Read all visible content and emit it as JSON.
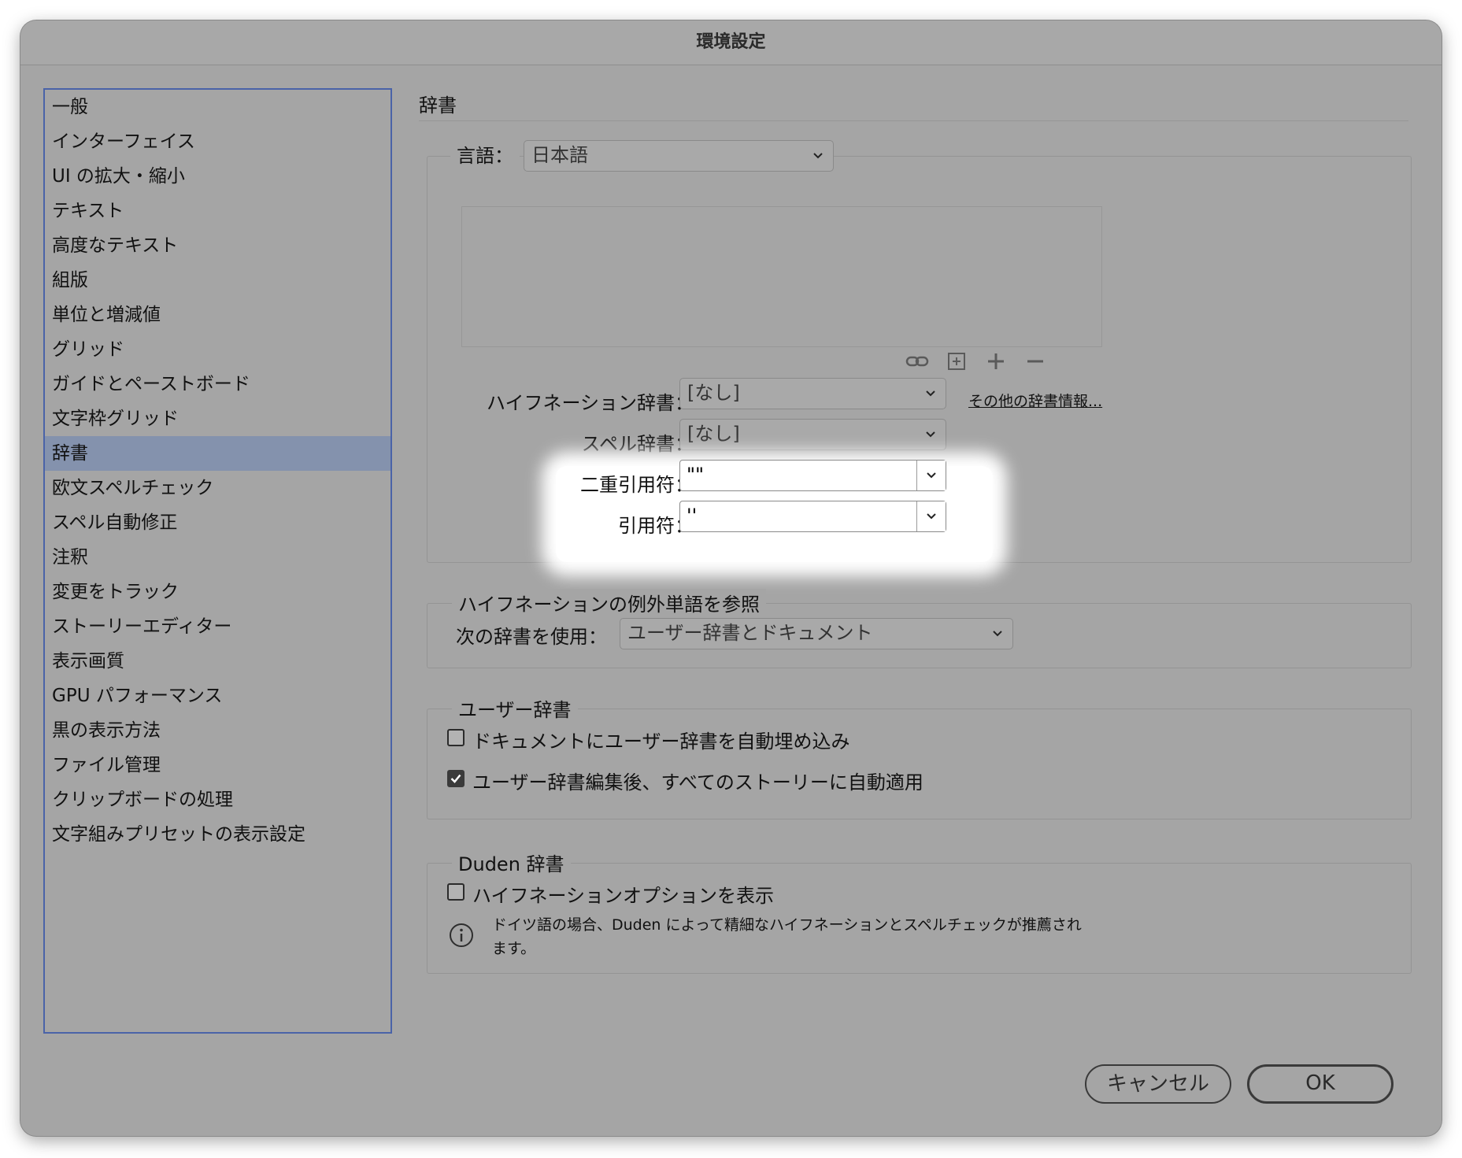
{
  "window": {
    "title": "環境設定"
  },
  "sidebar": {
    "items": [
      {
        "label": "一般"
      },
      {
        "label": "インターフェイス"
      },
      {
        "label": "UI の拡大・縮小"
      },
      {
        "label": "テキスト"
      },
      {
        "label": "高度なテキスト"
      },
      {
        "label": "組版"
      },
      {
        "label": "単位と増減値"
      },
      {
        "label": "グリッド"
      },
      {
        "label": "ガイドとペーストボード"
      },
      {
        "label": "文字枠グリッド"
      },
      {
        "label": "辞書",
        "selected": true
      },
      {
        "label": "欧文スペルチェック"
      },
      {
        "label": "スペル自動修正"
      },
      {
        "label": "注釈"
      },
      {
        "label": "変更をトラック"
      },
      {
        "label": "ストーリーエディター"
      },
      {
        "label": "表示画質"
      },
      {
        "label": "GPU パフォーマンス"
      },
      {
        "label": "黒の表示方法"
      },
      {
        "label": "ファイル管理"
      },
      {
        "label": "クリップボードの処理"
      },
      {
        "label": "文字組みプリセットの表示設定"
      }
    ],
    "selected_color": "#8492ad"
  },
  "main": {
    "title": "辞書",
    "language": {
      "label": "言語：",
      "value": "日本語"
    },
    "toolbar_icons": [
      "link-icon",
      "add-box-icon",
      "plus-icon",
      "minus-icon"
    ],
    "hyphenation_dict": {
      "label": "ハイフネーション辞書：",
      "value": "[なし]"
    },
    "more_info_link": "その他の辞書情報...",
    "spell_dict": {
      "label": "スペル辞書：",
      "value": "[なし]"
    },
    "double_quotes": {
      "label": "二重引用符：",
      "value": "\"\""
    },
    "single_quotes": {
      "label": "引用符：",
      "value": "''"
    },
    "exceptions": {
      "legend": "ハイフネーションの例外単語を参照",
      "label": "次の辞書を使用：",
      "value": "ユーザー辞書とドキュメント"
    },
    "user_dict": {
      "legend": "ユーザー辞書",
      "embed": {
        "label": "ドキュメントにユーザー辞書を自動埋め込み",
        "checked": false
      },
      "apply": {
        "label": "ユーザー辞書編集後、すべてのストーリーに自動適用",
        "checked": true
      }
    },
    "duden": {
      "legend": "Duden 辞書",
      "show_options": {
        "label": "ハイフネーションオプションを表示",
        "checked": false
      },
      "info": "ドイツ語の場合、Duden によって精細なハイフネーションとスペルチェックが推薦されます。"
    }
  },
  "buttons": {
    "cancel": "キャンセル",
    "ok": "OK"
  },
  "colors": {
    "window_bg": "#a5a5a5",
    "sidebar_border": "#4a63a8"
  }
}
